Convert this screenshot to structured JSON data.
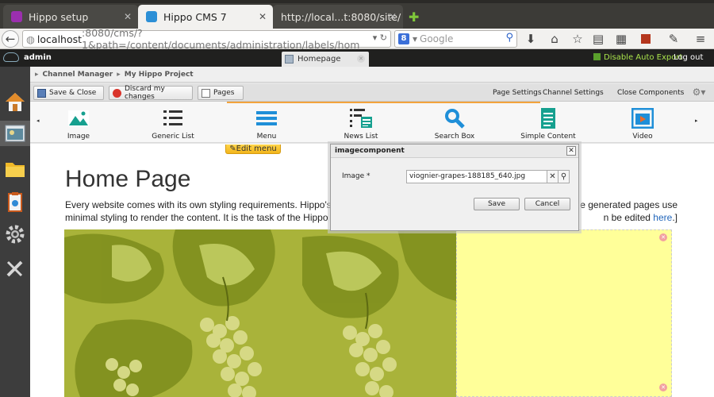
{
  "browser": {
    "tabs": [
      {
        "title": "Hippo setup",
        "color": "#9b2fae"
      },
      {
        "title": "Hippo CMS 7",
        "color": "#2c8fd6"
      },
      {
        "title": "http://local...t:8080/site/",
        "color": "#666666"
      }
    ],
    "new_tab_icon": "plus-icon",
    "url_host": "localhost",
    "url_rest": ":8080/cms/?1&path=/content/documents/administration/labels/hom",
    "search_placeholder": "Google"
  },
  "hippo": {
    "user": "admin",
    "open_tab": "Homepage",
    "auto_export": "Disable Auto Export",
    "logout": "Log out"
  },
  "breadcrumb": {
    "items": [
      "Channel Manager",
      "My Hippo Project"
    ]
  },
  "toolbar": {
    "save_close": "Save & Close",
    "discard": "Discard my changes",
    "pages": "Pages",
    "page_settings": "Page Settings",
    "channel_settings": "Channel Settings",
    "close_components": "Close Components"
  },
  "components": [
    {
      "label": "Image",
      "icon": "image-icon"
    },
    {
      "label": "Generic List",
      "icon": "list-icon"
    },
    {
      "label": "Menu",
      "icon": "menu-icon"
    },
    {
      "label": "News List",
      "icon": "news-list-icon"
    },
    {
      "label": "Search Box",
      "icon": "search-box-icon"
    },
    {
      "label": "Simple Content",
      "icon": "document-icon"
    },
    {
      "label": "Video",
      "icon": "video-icon"
    }
  ],
  "preview": {
    "edit_menu": "Edit menu",
    "title": "Home Page",
    "text_line1": "Every website comes with its own styling requirements. Hippo's setu",
    "text_line1_end": "e generated pages use",
    "text_line2": "minimal styling to render the content. It is the task of the Hippo deve",
    "text_line2_end": "n be edited",
    "link": "here",
    "link_suffix": ".]"
  },
  "dialog": {
    "title": "imagecomponent",
    "image_label": "Image *",
    "image_value": "viognier-grapes-188185_640.jpg",
    "save": "Save",
    "cancel": "Cancel"
  }
}
